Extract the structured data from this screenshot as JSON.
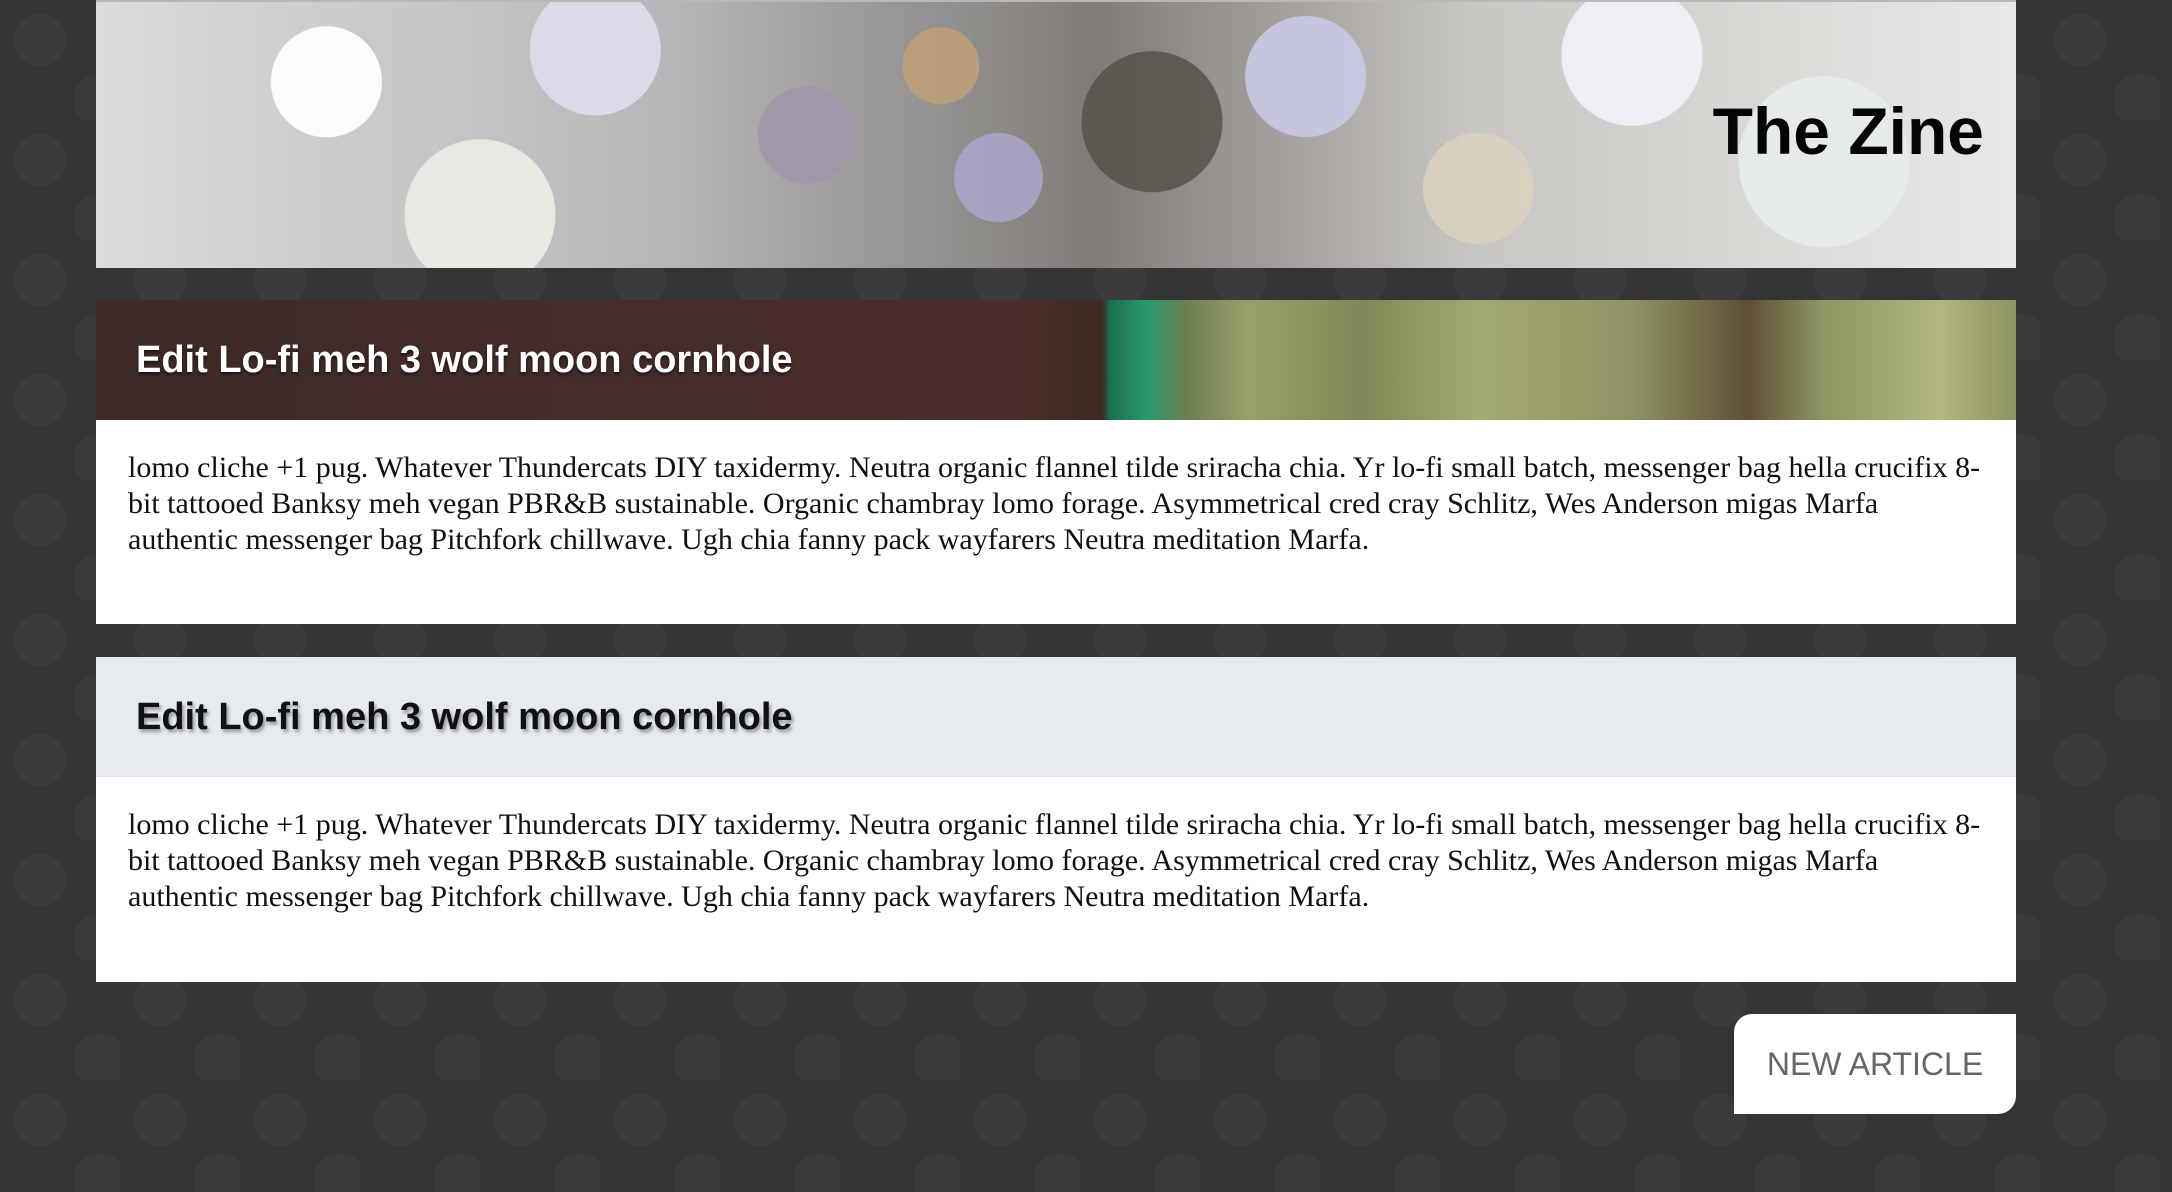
{
  "header": {
    "site_title": "The Zine"
  },
  "articles": [
    {
      "title": "Edit Lo-fi meh 3 wolf moon cornhole",
      "body": "lomo cliche +1 pug. Whatever Thundercats DIY taxidermy. Neutra organic flannel tilde sriracha chia. Yr lo-fi small batch, messenger bag hella crucifix 8-bit tattooed Banksy meh vegan PBR&B sustainable. Organic chambray lomo forage. Asymmetrical cred cray Schlitz, Wes Anderson migas Marfa authentic messenger bag Pitchfork chillwave. Ugh chia fanny pack wayfarers Neutra meditation Marfa."
    },
    {
      "title": "Edit Lo-fi meh 3 wolf moon cornhole",
      "body": "lomo cliche +1 pug. Whatever Thundercats DIY taxidermy. Neutra organic flannel tilde sriracha chia. Yr lo-fi small batch, messenger bag hella crucifix 8-bit tattooed Banksy meh vegan PBR&B sustainable. Organic chambray lomo forage. Asymmetrical cred cray Schlitz, Wes Anderson migas Marfa authentic messenger bag Pitchfork chillwave. Ugh chia fanny pack wayfarers Neutra meditation Marfa."
    }
  ],
  "actions": {
    "new_article_label": "NEW ARTICLE"
  },
  "colors": {
    "page_background": "#343434",
    "card_background": "#ffffff",
    "second_header_background": "#e6ebf0",
    "button_text": "#666666"
  }
}
